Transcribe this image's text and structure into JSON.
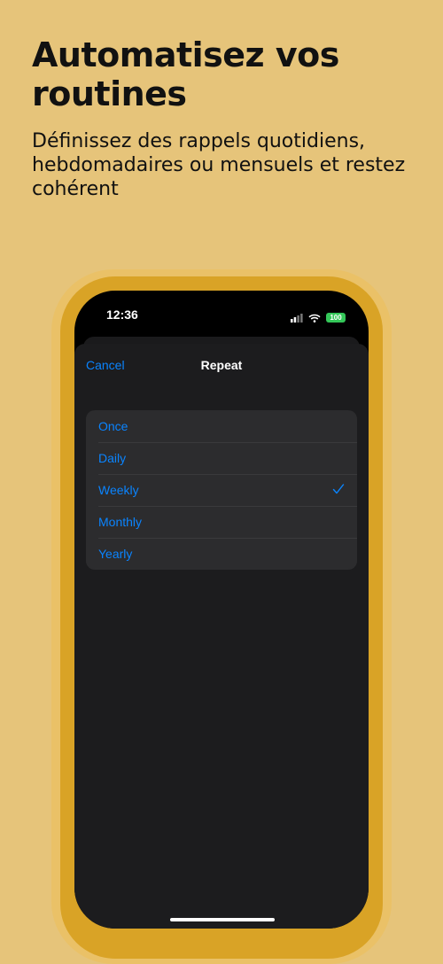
{
  "marketing": {
    "headline": "Automatisez vos routines",
    "subheadline": "Définissez des rappels quotidiens, hebdomadaires ou mensuels et restez cohérent"
  },
  "status_bar": {
    "time": "12:36",
    "battery": "100",
    "icons": [
      "cellular-signal-icon",
      "wifi-icon",
      "battery-icon"
    ]
  },
  "nav": {
    "cancel_label": "Cancel",
    "title": "Repeat"
  },
  "repeat_options": [
    {
      "label": "Once",
      "selected": false
    },
    {
      "label": "Daily",
      "selected": false
    },
    {
      "label": "Weekly",
      "selected": true
    },
    {
      "label": "Monthly",
      "selected": false
    },
    {
      "label": "Yearly",
      "selected": false
    }
  ],
  "colors": {
    "background": "#E6C47A",
    "phone_frame": "#D9A326",
    "accent": "#0A84FF",
    "sheet": "#1C1C1E",
    "list_group": "#2C2C2E",
    "battery": "#34C759"
  }
}
